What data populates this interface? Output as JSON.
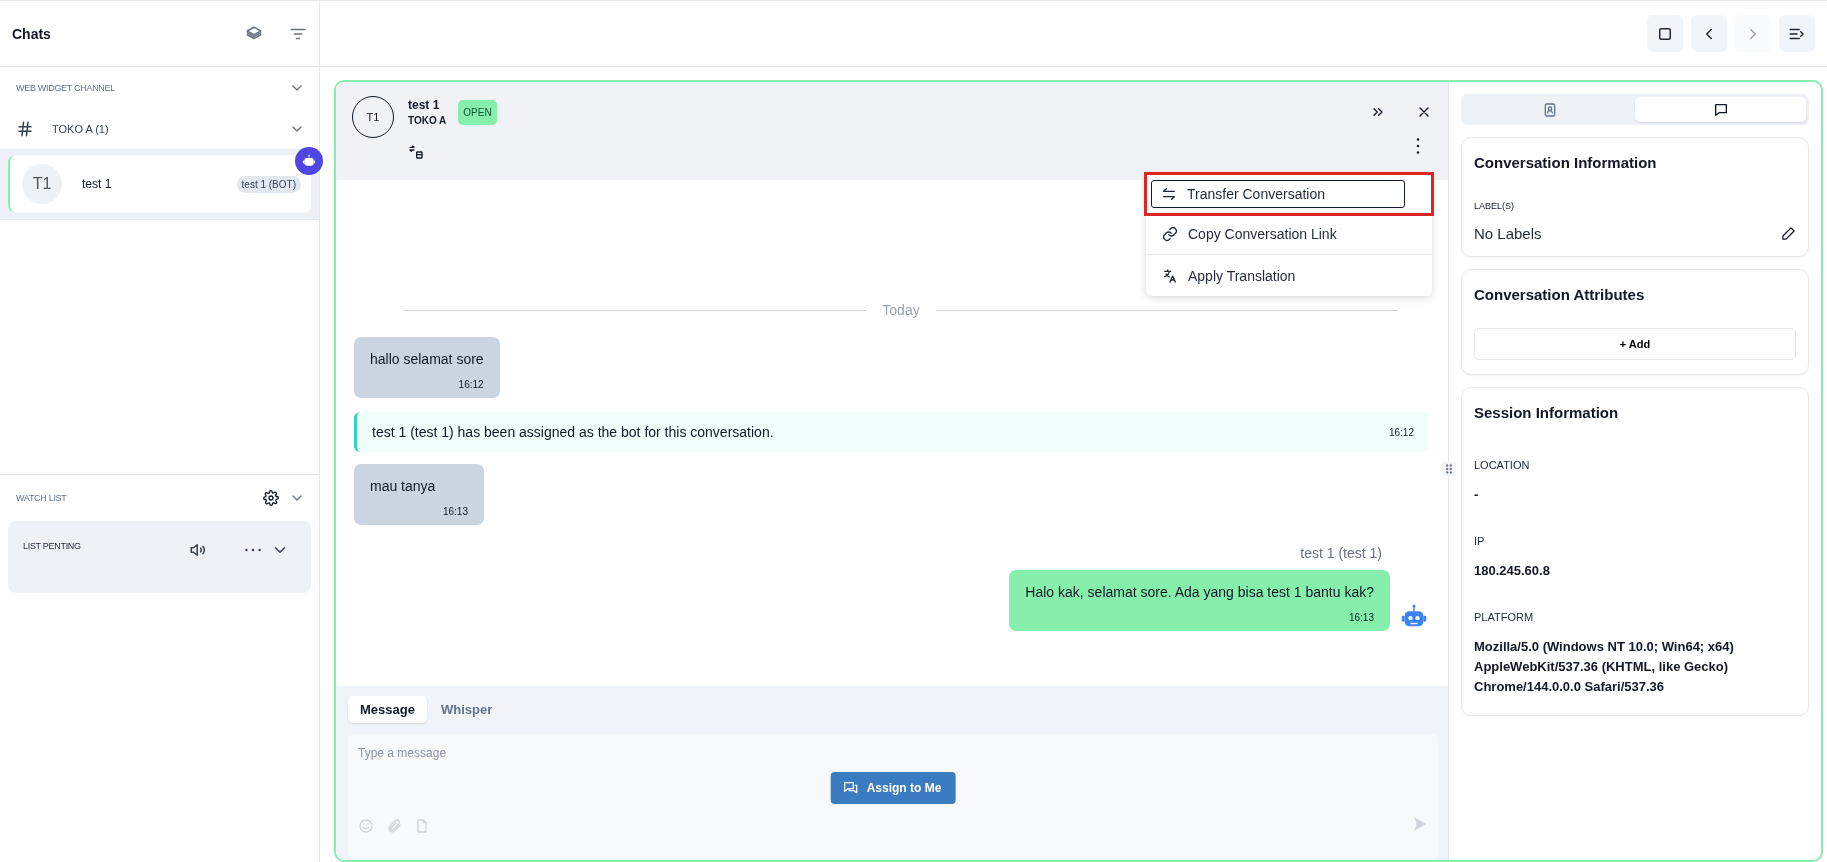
{
  "sidebar": {
    "title": "Chats",
    "channel_section": {
      "title": "WEB WIDGET CHANNEL",
      "expanded": true
    },
    "inbox": {
      "name": "TOKO A (1)",
      "expanded": true
    },
    "conversations": [
      {
        "avatar": "T1",
        "name": "test 1",
        "badge": "test 1 (BOT)",
        "selected": true,
        "bot": true
      }
    ],
    "watch_list": {
      "title": "WATCH LIST",
      "expanded": true,
      "lists": [
        {
          "name": "LIST PENTING",
          "expanded": false
        }
      ]
    }
  },
  "toolbar": {
    "buttons": [
      {
        "kind": "square",
        "disabled": false
      },
      {
        "kind": "prev",
        "disabled": false
      },
      {
        "kind": "next",
        "disabled": true
      },
      {
        "kind": "panel",
        "disabled": false
      }
    ]
  },
  "conversation": {
    "avatar": "T1",
    "name": "test 1",
    "inbox": "TOKO A",
    "status": "OPEN",
    "menu": [
      {
        "kind": "transfer",
        "label": "Transfer Conversation",
        "highlighted": true
      },
      {
        "kind": "link",
        "label": "Copy Conversation Link",
        "highlighted": false
      },
      {
        "kind": "translate",
        "label": "Apply Translation",
        "highlighted": false
      }
    ],
    "date_divider": "Today",
    "messages": [
      {
        "kind": "incoming",
        "text": "hallo selamat sore",
        "time": "16:12"
      },
      {
        "kind": "activity",
        "text": "test 1 (test 1) has been assigned as the bot for this conversation.",
        "time": "16:12"
      },
      {
        "kind": "incoming",
        "text": "mau tanya",
        "time": "16:13"
      },
      {
        "kind": "outgoing",
        "sender": "test 1 (test 1)",
        "text": "Halo kak, selamat sore. Ada yang bisa test 1 bantu kak?",
        "time": "16:13"
      }
    ],
    "composer": {
      "tabs": [
        {
          "label": "Message",
          "selected": true
        },
        {
          "label": "Whisper",
          "selected": false
        }
      ],
      "placeholder": "Type a message",
      "assign_button": "Assign to Me"
    }
  },
  "details": {
    "tabs": [
      {
        "kind": "contact",
        "selected": false
      },
      {
        "kind": "conversation",
        "selected": true
      }
    ],
    "cards": [
      {
        "kind": "labels",
        "title": "Conversation Information",
        "caption": "LABEL(S)",
        "value": "No Labels"
      },
      {
        "kind": "attributes",
        "title": "Conversation Attributes",
        "button": "+ Add"
      },
      {
        "kind": "fields",
        "title": "Session Information",
        "fields": [
          {
            "label": "LOCATION",
            "value": "-"
          },
          {
            "label": "IP",
            "value": "180.245.60.8"
          },
          {
            "label": "PLATFORM",
            "value": "Mozilla/5.0 (Windows NT 10.0; Win64; x64) AppleWebKit/537.36 (KHTML, like Gecko) Chrome/144.0.0.0 Safari/537.36"
          }
        ]
      }
    ]
  }
}
